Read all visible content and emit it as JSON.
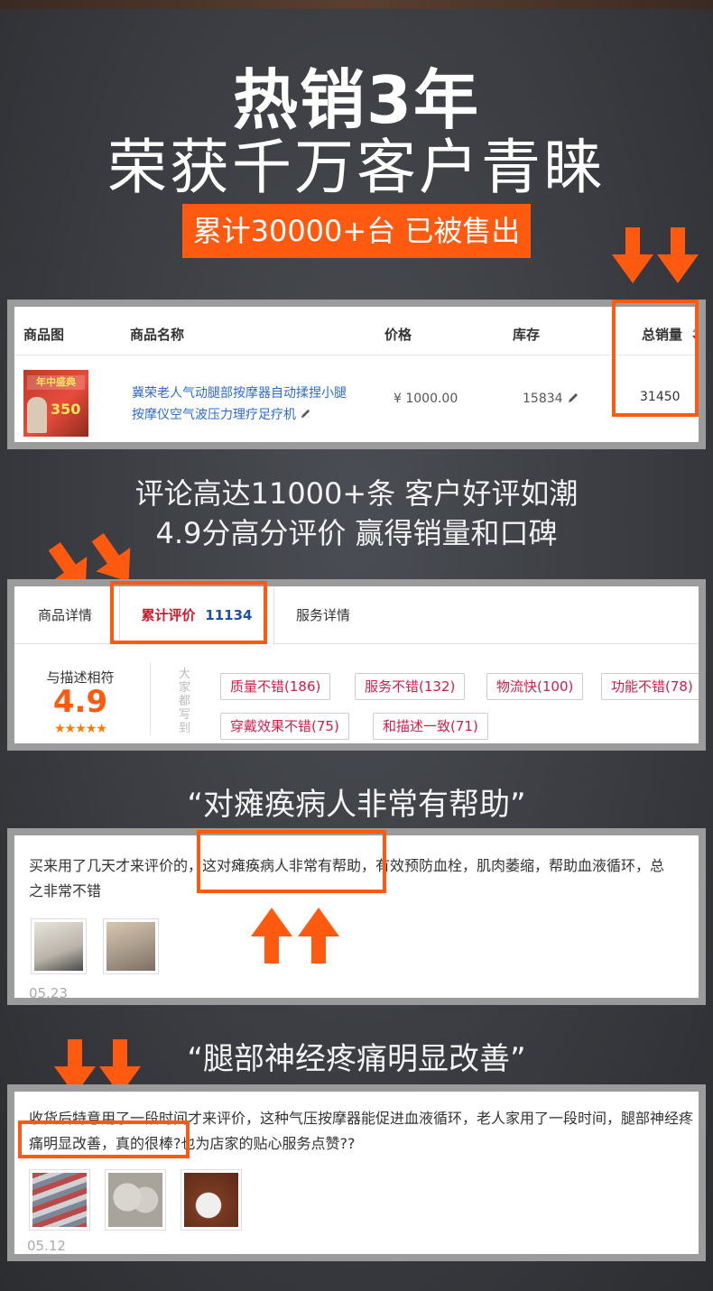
{
  "header": {
    "title_line1": "热销3年",
    "title_line2": "荣获千万客户青睐",
    "badge": "累计30000+台 已被售出"
  },
  "product_table": {
    "columns": [
      "商品图",
      "商品名称",
      "价格",
      "库存",
      "总销量"
    ],
    "sort_icon": "sort-arrows-icon",
    "row": {
      "image_label": "年中盛典",
      "image_price": "350",
      "name": "冀荣老人气动腿部按摩器自动揉捏小腿按摩仪空气波压力理疗足疗机",
      "price": "¥ 1000.00",
      "stock": "15834",
      "sales": "31450"
    }
  },
  "section2": {
    "line1": "评论高达11000+条 客户好评如潮",
    "line2": "4.9分高分评价 赢得销量和口碑"
  },
  "reviews_panel": {
    "tabs": {
      "details": "商品详情",
      "reviews_label": "累计评价",
      "reviews_count": "11134",
      "service": "服务详情"
    },
    "rating_label": "与描述相符",
    "rating_value": "4.9",
    "stars": "★★★★★",
    "side_label": "大家都写到",
    "tags": [
      "质量不错(186)",
      "服务不错(132)",
      "物流快(100)",
      "功能不错(78)",
      "穿戴效果不错(75)",
      "和描述一致(71)"
    ]
  },
  "quote1": "“对瘫痪病人非常有帮助”",
  "review1": {
    "text_before": "买来用了几天才来评价的，",
    "highlight": "这对瘫痪病人非常有帮助",
    "text_after": "，有效预防血栓，肌肉萎缩，帮助血液循环，总之非常不错",
    "date": "05.23"
  },
  "quote2": "“腿部神经疼痛明显改善”",
  "review2": {
    "text_before": "收货后特意用了一段时间才来评价，这种气压按摩器能促进血液循环，老人家用了一段时间，",
    "highlight": "腿部神经疼痛明显改善",
    "text_after": "，真的很棒?也为店家的贴心服务点赞??",
    "date": "05.12"
  },
  "colors": {
    "accent": "#ff5a0f",
    "link": "#2d6ac9",
    "tag_text": "#d31c49",
    "reviews_count": "#1f4fa8"
  }
}
